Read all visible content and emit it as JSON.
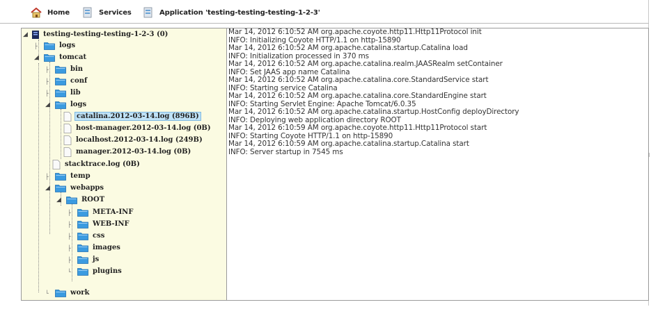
{
  "breadcrumb": {
    "home": "Home",
    "services": "Services",
    "application": "Application 'testing-testing-testing-1-2-3'"
  },
  "tree": {
    "root": "testing-testing-testing-1-2-3 (0)",
    "nodes": [
      {
        "label": "logs"
      },
      {
        "label": "tomcat"
      },
      {
        "label": "bin"
      },
      {
        "label": "conf"
      },
      {
        "label": "lib"
      },
      {
        "label": "logs"
      },
      {
        "label": "catalina.2012-03-14.log (896B)"
      },
      {
        "label": "host-manager.2012-03-14.log (0B)"
      },
      {
        "label": "localhost.2012-03-14.log (249B)"
      },
      {
        "label": "manager.2012-03-14.log (0B)"
      },
      {
        "label": "stacktrace.log (0B)"
      },
      {
        "label": "temp"
      },
      {
        "label": "webapps"
      },
      {
        "label": "ROOT"
      },
      {
        "label": "META-INF"
      },
      {
        "label": "WEB-INF"
      },
      {
        "label": "css"
      },
      {
        "label": "images"
      },
      {
        "label": "js"
      },
      {
        "label": "plugins"
      },
      {
        "label": "work"
      }
    ]
  },
  "log": {
    "lines": [
      "Mar 14, 2012 6:10:52 AM org.apache.coyote.http11.Http11Protocol init",
      "INFO: Initializing Coyote HTTP/1.1 on http-15890",
      "Mar 14, 2012 6:10:52 AM org.apache.catalina.startup.Catalina load",
      "INFO: Initialization processed in 370 ms",
      "Mar 14, 2012 6:10:52 AM org.apache.catalina.realm.JAASRealm setContainer",
      "INFO: Set JAAS app name Catalina",
      "Mar 14, 2012 6:10:52 AM org.apache.catalina.core.StandardService start",
      "INFO: Starting service Catalina",
      "Mar 14, 2012 6:10:52 AM org.apache.catalina.core.StandardEngine start",
      "INFO: Starting Servlet Engine: Apache Tomcat/6.0.35",
      "Mar 14, 2012 6:10:52 AM org.apache.catalina.startup.HostConfig deployDirectory",
      "INFO: Deploying web application directory ROOT",
      "Mar 14, 2012 6:10:59 AM org.apache.coyote.http11.Http11Protocol start",
      "INFO: Starting Coyote HTTP/1.1 on http-15890",
      "Mar 14, 2012 6:10:59 AM org.apache.catalina.startup.Catalina start",
      "INFO: Server startup in 7545 ms"
    ]
  },
  "colors": {
    "tree_background": "#fbfbe2",
    "selection": "#bfe2f7",
    "folder": "#3b9be0"
  },
  "icons": {
    "home": "home-icon",
    "services": "services-icon",
    "application": "application-icon",
    "server": "server-icon",
    "folder": "folder-icon",
    "file": "file-icon",
    "expanded": "expanded-toggle-icon",
    "collapsed": "collapsed-toggle-icon"
  }
}
